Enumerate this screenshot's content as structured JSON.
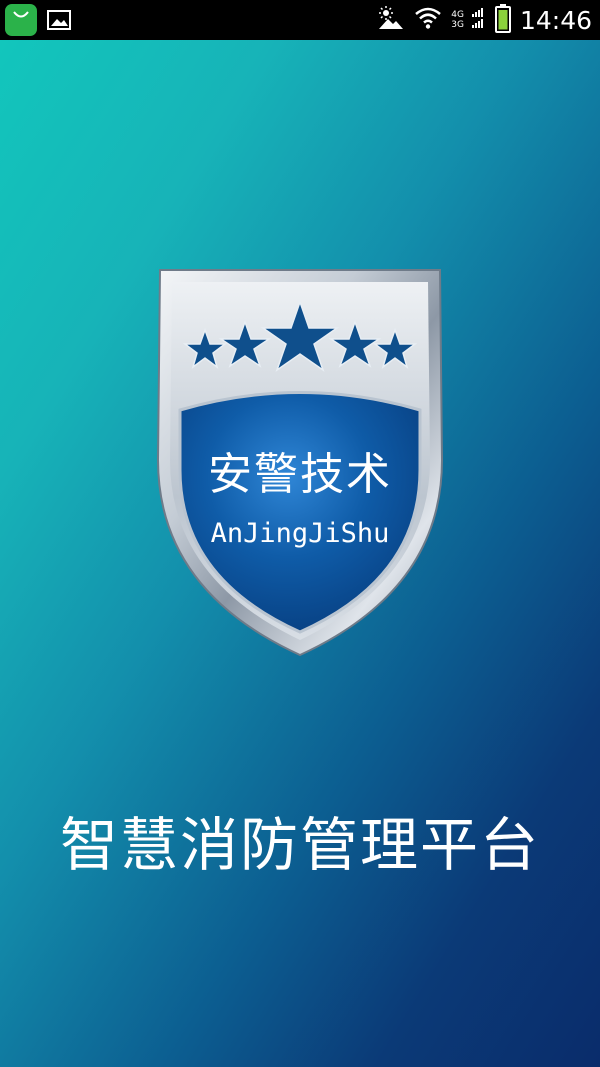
{
  "status_bar": {
    "time": "14:46",
    "network_top": "4G",
    "network_bottom": "3G",
    "icons": [
      "shopping-bag-icon",
      "gallery-icon",
      "weather-icon",
      "wifi-icon",
      "signal-icon",
      "battery-icon"
    ]
  },
  "logo": {
    "title_cn": "安警技术",
    "title_en": "AnJingJiShu",
    "star_count": 5
  },
  "app": {
    "title": "智慧消防管理平台"
  },
  "colors": {
    "gradient_start": "#12c6bc",
    "gradient_end": "#0a2c6b",
    "shield_blue": "#0d5fae",
    "star_blue": "#0f4f8c",
    "silver": "#c9d2dc"
  }
}
